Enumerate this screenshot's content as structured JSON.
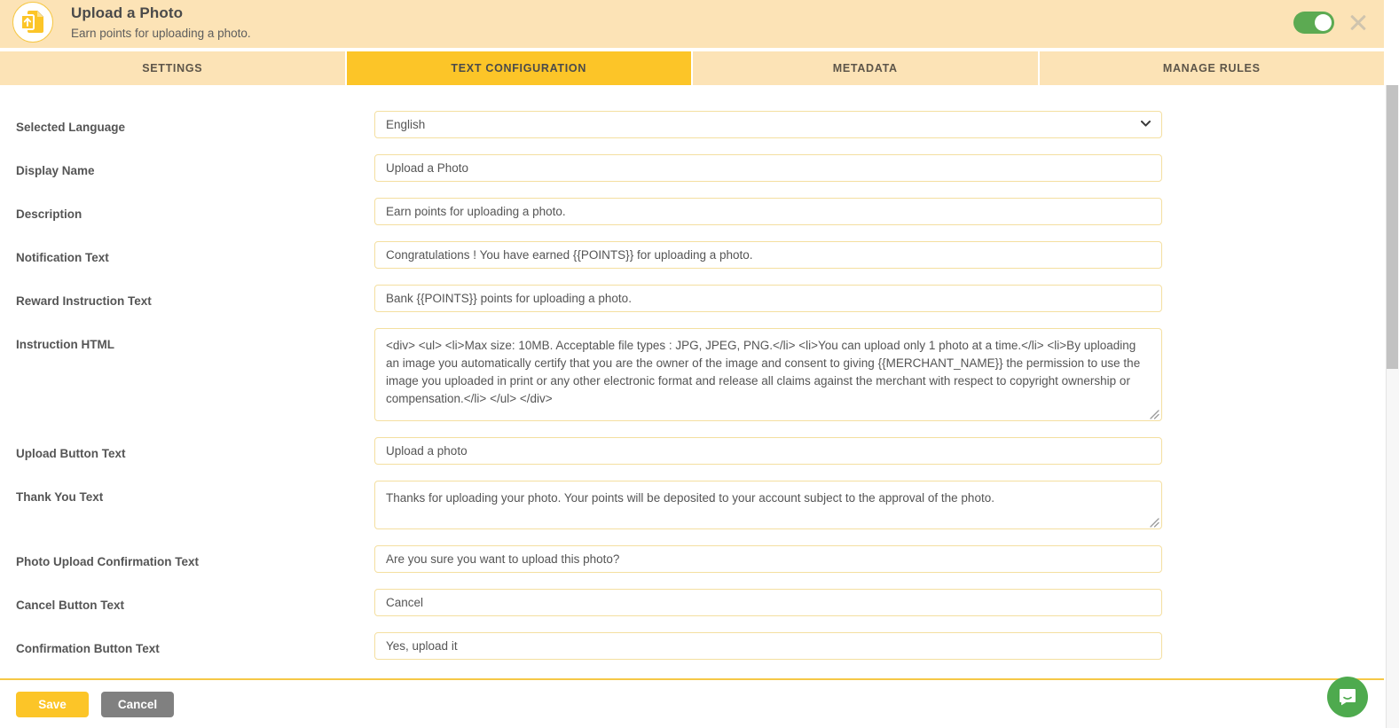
{
  "header": {
    "icon": "file-upload-icon",
    "title": "Upload a Photo",
    "subtitle": "Earn points for uploading a photo.",
    "toggle_icon": "toggle-on-icon",
    "close_icon": "close-icon",
    "bg_color": "#fce3b6",
    "toggle_color": "#5caa52"
  },
  "tabs": [
    {
      "label": "SETTINGS",
      "active": false
    },
    {
      "label": "TEXT CONFIGURATION",
      "active": true
    },
    {
      "label": "METADATA",
      "active": false
    },
    {
      "label": "MANAGE RULES",
      "active": false
    }
  ],
  "form": {
    "selected_language": {
      "label": "Selected Language",
      "value": "English",
      "chevron_icon": "chevron-down-icon"
    },
    "display_name": {
      "label": "Display Name",
      "value": "Upload a Photo"
    },
    "description": {
      "label": "Description",
      "value": "Earn points for uploading a photo."
    },
    "notification_text": {
      "label": "Notification Text",
      "value": "Congratulations ! You have earned {{POINTS}} for uploading a photo."
    },
    "reward_instruction_text": {
      "label": "Reward Instruction Text",
      "value": "Bank {{POINTS}} points for uploading a photo."
    },
    "instruction_html": {
      "label": "Instruction HTML",
      "value": "<div> <ul> <li>Max size: 10MB. Acceptable file types : JPG, JPEG, PNG.</li> <li>You can upload only 1 photo at a time.</li> <li>By uploading an image you automatically certify that you are the owner of the image and consent to giving {{MERCHANT_NAME}} the permission to use the image you uploaded in print or any other electronic format and release all claims against the merchant with respect to copyright ownership or compensation.</li> </ul> </div>",
      "resize_icon": "resize-handle-icon"
    },
    "upload_button_text": {
      "label": "Upload Button Text",
      "value": "Upload a photo"
    },
    "thank_you_text": {
      "label": "Thank You Text",
      "value": "Thanks for uploading your photo. Your points will be deposited to your account subject to the approval of the photo.",
      "resize_icon": "resize-handle-icon"
    },
    "photo_upload_confirmation_text": {
      "label": "Photo Upload Confirmation Text",
      "value": "Are you sure you want to upload this photo?"
    },
    "cancel_button_text": {
      "label": "Cancel Button Text",
      "value": "Cancel"
    },
    "confirmation_button_text": {
      "label": "Confirmation Button Text",
      "value": "Yes, upload it"
    }
  },
  "footer": {
    "save_label": "Save",
    "cancel_label": "Cancel",
    "save_color": "#fcc528",
    "cancel_color": "#808080"
  },
  "chat": {
    "icon": "chat-bubble-icon",
    "color": "#4eaa4e"
  }
}
